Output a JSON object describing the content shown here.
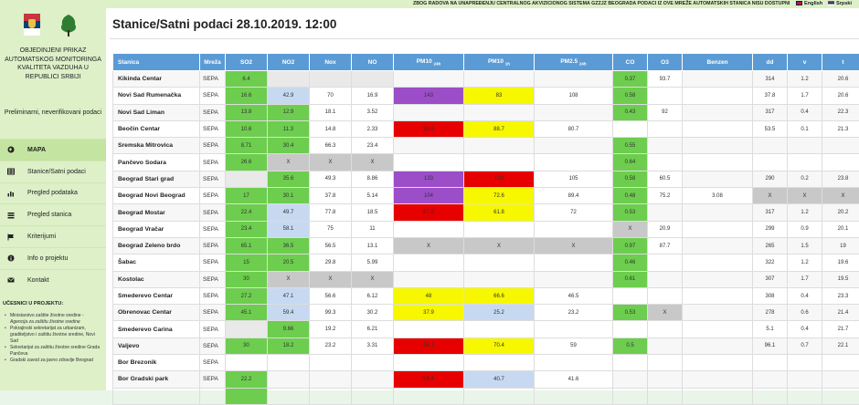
{
  "topbar": {
    "text": "ZBOG RADOVA NA UNAPREĐENJU CENTRALNOG AKVIZICIONOG SISTEMA GZZJZ BEOGRADA PODACI IZ OVE MREŽE AUTOMATSKIH STANICA NISU DOSTUPNI",
    "lang_english": "English",
    "lang_serbian": "Srpski"
  },
  "sidebar": {
    "org": "OBJEDINJENI PRIKAZ AUTOMATSKOG MONITORINGA KVALITETA VAZDUHA U REPUBLICI SRBIJI",
    "prelim": "Preliminarni, neverifikovani podaci",
    "nav": [
      {
        "label": "MAPA",
        "icon": "globe-icon"
      },
      {
        "label": "Stanice/Satni podaci",
        "icon": "table-icon"
      },
      {
        "label": "Pregled podataka",
        "icon": "bar-chart-icon"
      },
      {
        "label": "Pregled stanica",
        "icon": "list-icon"
      },
      {
        "label": "Kriterijumi",
        "icon": "flag-icon"
      },
      {
        "label": "Info o projektu",
        "icon": "info-icon"
      },
      {
        "label": "Kontakt",
        "icon": "mail-icon"
      }
    ],
    "ucesnici": "UČESNICI U PROJEKTU:",
    "members": [
      {
        "text": "Ministarstvo zaštite životne sredine -",
        "sub": "Agencija za zaštitu životne sredine"
      },
      {
        "text": "Pokrajinski sekretarijat za urbanizam, graditeljstvo i zaštitu životne sredine, Novi Sad",
        "sub": ""
      },
      {
        "text": "Sekretarijat za zaštitu životne sredine Grada Pančeva",
        "sub": ""
      },
      {
        "text": "Gradski zavod za javno zdravlje Beograd",
        "sub": ""
      }
    ]
  },
  "main": {
    "title": "Stanice/Satni podaci 28.10.2019. 12:00",
    "columns": [
      "Stanica",
      "Mreža",
      "SO2",
      "NO2",
      "Nox",
      "NO",
      "PM10",
      "PM10",
      "PM2.5",
      "CO",
      "O3",
      "Benzen",
      "dd",
      "v",
      "t"
    ],
    "subs": [
      "",
      "",
      "",
      "",
      "",
      "",
      "24h",
      "1h",
      "24h",
      "",
      "",
      "",
      "",
      "",
      ""
    ],
    "colors": {
      "green": "#6dcd4e",
      "lightblue": "#c6d9f1",
      "purple": "#9b4ec8",
      "yellow": "#f7f700",
      "red": "#e60000",
      "gray": "#c8c8c8",
      "header": "#5b9bd5"
    },
    "rows": [
      [
        "Kikinda Centar",
        "SEPA",
        "6.4",
        "",
        "",
        "",
        "",
        "",
        "",
        "0.37",
        "93.7",
        "",
        "314",
        "1.2",
        "20.6"
      ],
      [
        "Novi Sad Rumenačka",
        "SEPA",
        "16.6",
        "42.9",
        "70",
        "16.9",
        "143",
        "83",
        "108",
        "0.58",
        "",
        "",
        "37.8",
        "1.7",
        "20.6"
      ],
      [
        "Novi Sad Liman",
        "SEPA",
        "13.8",
        "12.9",
        "18.1",
        "3.52",
        "",
        "",
        "",
        "0.43",
        "92",
        "",
        "317",
        "0.4",
        "22.3"
      ],
      [
        "Beočin Centar",
        "SEPA",
        "10.6",
        "11.3",
        "14.8",
        "2.33",
        "99.6",
        "88.7",
        "80.7",
        "",
        "",
        "",
        "53.5",
        "0.1",
        "21.3"
      ],
      [
        "Sremska Mitrovica",
        "SEPA",
        "8.71",
        "30.4",
        "66.3",
        "23.4",
        "",
        "",
        "",
        "0.55",
        "",
        "",
        "",
        "",
        ""
      ],
      [
        "Pančevo Sodara",
        "SEPA",
        "26.6",
        "X",
        "X",
        "X",
        "",
        "",
        "",
        "0.64",
        "",
        "",
        "",
        "",
        ""
      ],
      [
        "Beograd Stari grad",
        "SEPA",
        "",
        "35.6",
        "49.3",
        "8.86",
        "133",
        "109",
        "105",
        "0.58",
        "60.5",
        "",
        "290",
        "0.2",
        "23.8"
      ],
      [
        "Beograd Novi Beograd",
        "SEPA",
        "17",
        "30.1",
        "37.8",
        "5.14",
        "104",
        "72.6",
        "89.4",
        "0.48",
        "75.2",
        "3.08",
        "X",
        "X",
        "X"
      ],
      [
        "Beograd Mostar",
        "SEPA",
        "22.4",
        "49.7",
        "77.8",
        "18.5",
        "67.3",
        "61.8",
        "72",
        "0.53",
        "",
        "",
        "317",
        "1.2",
        "20.2"
      ],
      [
        "Beograd Vračar",
        "SEPA",
        "23.4",
        "58.1",
        "75",
        "11",
        "",
        "",
        "",
        "X",
        "20.9",
        "",
        "299",
        "0.9",
        "20.1"
      ],
      [
        "Beograd Zeleno brdo",
        "SEPA",
        "65.1",
        "36.5",
        "56.5",
        "13.1",
        "X",
        "X",
        "X",
        "0.97",
        "87.7",
        "",
        "265",
        "1.5",
        "19"
      ],
      [
        "Šabac",
        "SEPA",
        "15",
        "20.5",
        "29.8",
        "5.99",
        "",
        "",
        "",
        "0.46",
        "",
        "",
        "322",
        "1.2",
        "19.6"
      ],
      [
        "Kostolac",
        "SEPA",
        "30",
        "X",
        "X",
        "X",
        "",
        "",
        "",
        "0.61",
        "",
        "",
        "307",
        "1.7",
        "19.5"
      ],
      [
        "Smederevo Centar",
        "SEPA",
        "27.2",
        "47.1",
        "56.6",
        "6.12",
        "48",
        "66.6",
        "46.5",
        "",
        "",
        "",
        "308",
        "0.4",
        "23.3"
      ],
      [
        "Obrenovac Centar",
        "SEPA",
        "45.1",
        "59.4",
        "99.3",
        "30.2",
        "37.9",
        "25.2",
        "23.2",
        "0.53",
        "X",
        "",
        "278",
        "0.6",
        "21.4"
      ],
      [
        "Smederevo Carina",
        "SEPA",
        "",
        "9.66",
        "19.2",
        "6.21",
        "",
        "",
        "",
        "",
        "",
        "",
        "5.1",
        "0.4",
        "21.7"
      ],
      [
        "Valjevo",
        "SEPA",
        "30",
        "18.2",
        "23.2",
        "3.31",
        "56.1",
        "70.4",
        "59",
        "0.5",
        "",
        "",
        "96.1",
        "0.7",
        "22.1"
      ],
      [
        "Bor Brezonik",
        "SEPA",
        "",
        "",
        "",
        "",
        "",
        "",
        "",
        "",
        "",
        "",
        "",
        "",
        ""
      ],
      [
        "Bor Gradski park",
        "SEPA",
        "22.2",
        "",
        "",
        "",
        "58.4",
        "40.7",
        "41.6",
        "",
        "",
        "",
        "",
        "",
        ""
      ],
      [
        "",
        "",
        "",
        "",
        "",
        "",
        "",
        "",
        "",
        "",
        "",
        "",
        "",
        "",
        ""
      ]
    ],
    "cell_colors": [
      [
        "",
        "",
        "g",
        "e",
        "e",
        "e",
        "",
        "",
        "",
        "g",
        "w",
        "",
        "",
        "",
        ""
      ],
      [
        "",
        "",
        "g",
        "b",
        "w",
        "w",
        "p",
        "y",
        "w",
        "g",
        "w",
        "",
        "",
        "",
        ""
      ],
      [
        "",
        "",
        "g",
        "g",
        "w",
        "w",
        "",
        "",
        "",
        "g",
        "w",
        "",
        "",
        "",
        ""
      ],
      [
        "",
        "",
        "g",
        "g",
        "w",
        "w",
        "r",
        "y",
        "w",
        "",
        "",
        "",
        "",
        "",
        ""
      ],
      [
        "",
        "",
        "g",
        "g",
        "w",
        "w",
        "",
        "",
        "",
        "g",
        "",
        "",
        "",
        "",
        ""
      ],
      [
        "",
        "",
        "g",
        "gr",
        "gr",
        "gr",
        "",
        "",
        "",
        "g",
        "",
        "",
        "",
        "",
        ""
      ],
      [
        "",
        "",
        "e",
        "g",
        "w",
        "w",
        "p",
        "r",
        "w",
        "g",
        "w",
        "",
        "",
        "",
        ""
      ],
      [
        "",
        "",
        "g",
        "g",
        "w",
        "w",
        "p",
        "y",
        "w",
        "g",
        "w",
        "w",
        "gr",
        "gr",
        "gr"
      ],
      [
        "",
        "",
        "g",
        "b",
        "w",
        "w",
        "r",
        "y",
        "w",
        "g",
        "",
        "",
        "",
        "",
        ""
      ],
      [
        "",
        "",
        "g",
        "b",
        "w",
        "w",
        "",
        "",
        "",
        "gr",
        "w",
        "",
        "",
        "",
        ""
      ],
      [
        "",
        "",
        "g",
        "g",
        "w",
        "w",
        "gr",
        "gr",
        "gr",
        "g",
        "w",
        "",
        "",
        "",
        ""
      ],
      [
        "",
        "",
        "g",
        "g",
        "w",
        "w",
        "",
        "",
        "",
        "g",
        "",
        "",
        "",
        "",
        ""
      ],
      [
        "",
        "",
        "g",
        "gr",
        "gr",
        "gr",
        "",
        "",
        "",
        "g",
        "",
        "",
        "",
        "",
        ""
      ],
      [
        "",
        "",
        "g",
        "b",
        "w",
        "w",
        "y",
        "y",
        "w",
        "",
        "",
        "",
        "",
        "",
        ""
      ],
      [
        "",
        "",
        "g",
        "b",
        "w",
        "w",
        "y",
        "b",
        "w",
        "g",
        "gr",
        "",
        "",
        "",
        ""
      ],
      [
        "",
        "",
        "e",
        "g",
        "w",
        "w",
        "",
        "",
        "",
        "",
        "",
        "",
        "",
        "",
        ""
      ],
      [
        "",
        "",
        "g",
        "g",
        "w",
        "w",
        "r",
        "y",
        "w",
        "g",
        "",
        "",
        "",
        "",
        ""
      ],
      [
        "",
        "",
        "",
        "",
        "",
        "",
        "",
        "",
        "",
        "",
        "",
        "",
        "",
        "",
        ""
      ],
      [
        "",
        "",
        "g",
        "",
        "",
        "",
        "r",
        "b",
        "w",
        "",
        "",
        "",
        "",
        "",
        ""
      ],
      [
        "",
        "",
        "g",
        "",
        "",
        "",
        "",
        "",
        "",
        "",
        "",
        "",
        "",
        "",
        ""
      ]
    ]
  }
}
